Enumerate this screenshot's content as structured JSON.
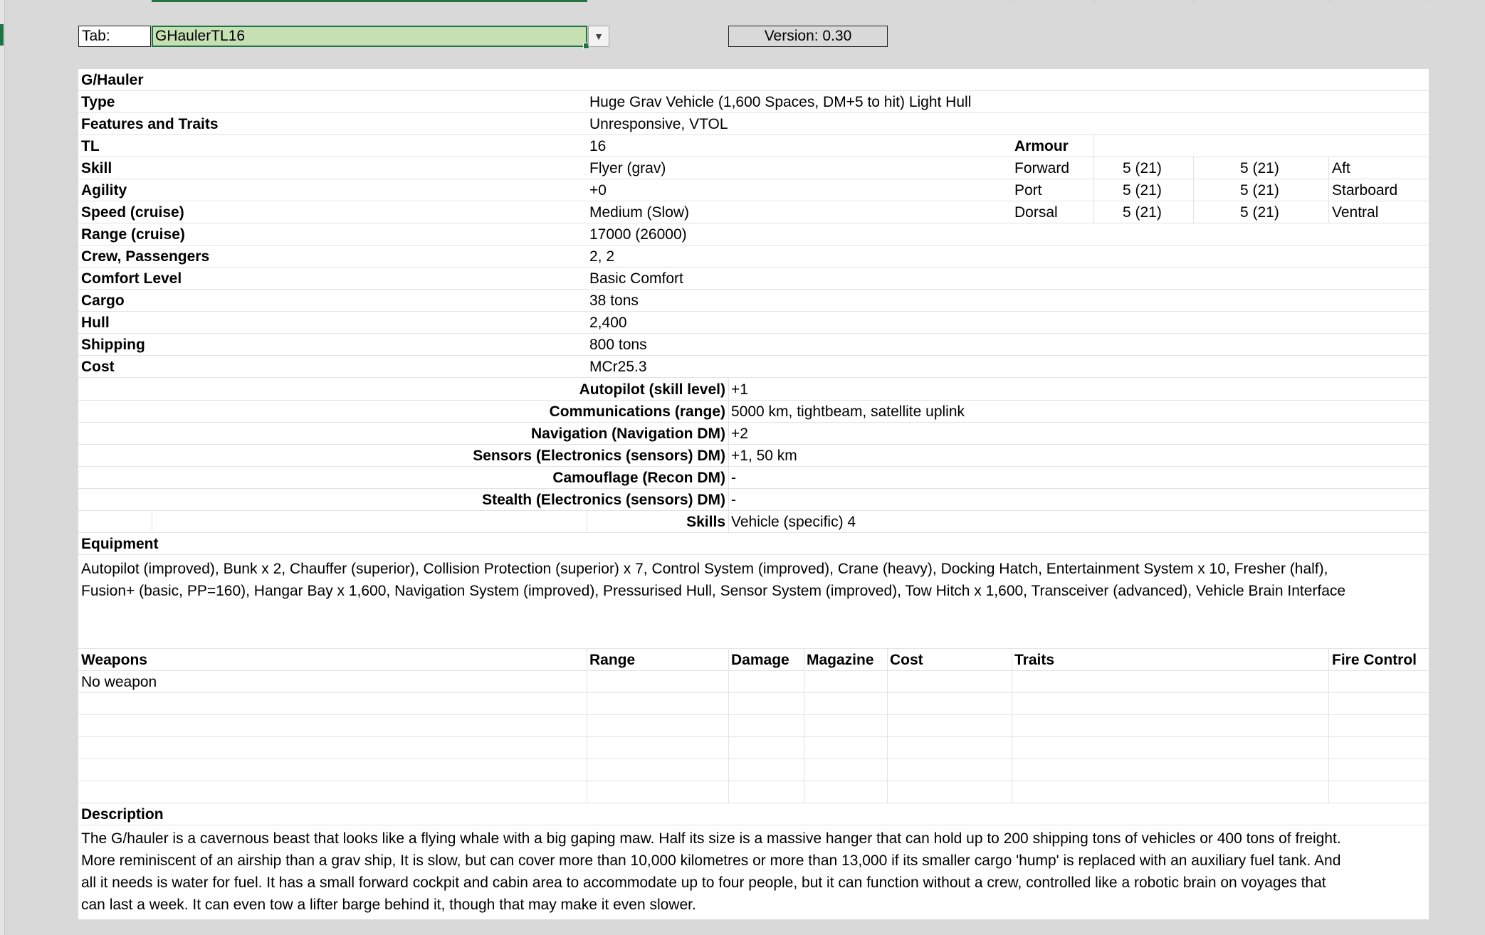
{
  "header": {
    "tab_label": "Tab:",
    "tab_value": "GHaulerTL16",
    "version": "Version: 0.30"
  },
  "vehicle": {
    "name": "G/Hauler",
    "specs": [
      {
        "label": "Type",
        "value": "Huge Grav Vehicle (1,600 Spaces, DM+5 to hit) Light Hull"
      },
      {
        "label": "Features and Traits",
        "value": "Unresponsive, VTOL"
      },
      {
        "label": "TL",
        "value": "16"
      },
      {
        "label": "Skill",
        "value": "Flyer (grav)"
      },
      {
        "label": "Agility",
        "value": "+0"
      },
      {
        "label": "Speed (cruise)",
        "value": "Medium (Slow)"
      },
      {
        "label": "Range (cruise)",
        "value": "17000 (26000)"
      },
      {
        "label": "Crew, Passengers",
        "value": "2, 2"
      },
      {
        "label": "Comfort Level",
        "value": "Basic Comfort"
      },
      {
        "label": "Cargo",
        "value": "38 tons"
      },
      {
        "label": "Hull",
        "value": "2,400"
      },
      {
        "label": "Shipping",
        "value": "800 tons"
      },
      {
        "label": "Cost",
        "value": "MCr25.3"
      }
    ],
    "armour": {
      "title": "Armour",
      "rows": [
        {
          "side": "Forward",
          "v1": "5 (21)",
          "v2": "5 (21)",
          "opposite": "Aft"
        },
        {
          "side": "Port",
          "v1": "5 (21)",
          "v2": "5 (21)",
          "opposite": "Starboard"
        },
        {
          "side": "Dorsal",
          "v1": "5 (21)",
          "v2": "5 (21)",
          "opposite": "Ventral"
        }
      ]
    },
    "systems": [
      {
        "label": "Autopilot (skill level)",
        "value": "+1"
      },
      {
        "label": "Communications (range)",
        "value": "5000 km, tightbeam, satellite uplink"
      },
      {
        "label": "Navigation (Navigation DM)",
        "value": "+2"
      },
      {
        "label": "Sensors (Electronics (sensors) DM)",
        "value": "+1, 50 km"
      },
      {
        "label": "Camouflage (Recon DM)",
        "value": "-"
      },
      {
        "label": "Stealth (Electronics (sensors) DM)",
        "value": "-"
      },
      {
        "label": "Skills",
        "value": "Vehicle (specific) 4"
      }
    ],
    "equipment": {
      "title": "Equipment",
      "line1": "Autopilot (improved), Bunk x 2, Chauffer (superior), Collision Protection (superior) x 7, Control System (improved), Crane (heavy), Docking Hatch, Entertainment System x 10, Fresher (half),",
      "line2": "Fusion+ (basic, PP=160), Hangar Bay x 1,600, Navigation System (improved), Pressurised Hull, Sensor System (improved), Tow Hitch x 1,600, Transceiver (advanced), Vehicle Brain Interface"
    },
    "weapons": {
      "headers": {
        "weapons": "Weapons",
        "range": "Range",
        "damage": "Damage",
        "magazine": "Magazine",
        "cost": "Cost",
        "traits": "Traits",
        "fire_control": "Fire Control"
      },
      "first_row": "No weapon"
    },
    "description": {
      "title": "Description",
      "lines": [
        "The G/hauler is a cavernous beast that looks like a flying whale with a big gaping maw. Half its size is a massive hanger that can hold up to 200 shipping tons of vehicles or 400 tons of freight.",
        "More reminiscent of an airship than a grav ship, It is slow, but can cover more than 10,000 kilometres or more than 13,000 if its smaller cargo 'hump' is replaced with an auxiliary fuel tank. And",
        "all it needs is water for fuel. It has a small forward cockpit and cabin area to accommodate up to four people, but it can function without a crew, controlled like a robotic brain on voyages that",
        "can last a week. It can even tow a lifter barge behind it, though that may make it even slower."
      ]
    }
  }
}
